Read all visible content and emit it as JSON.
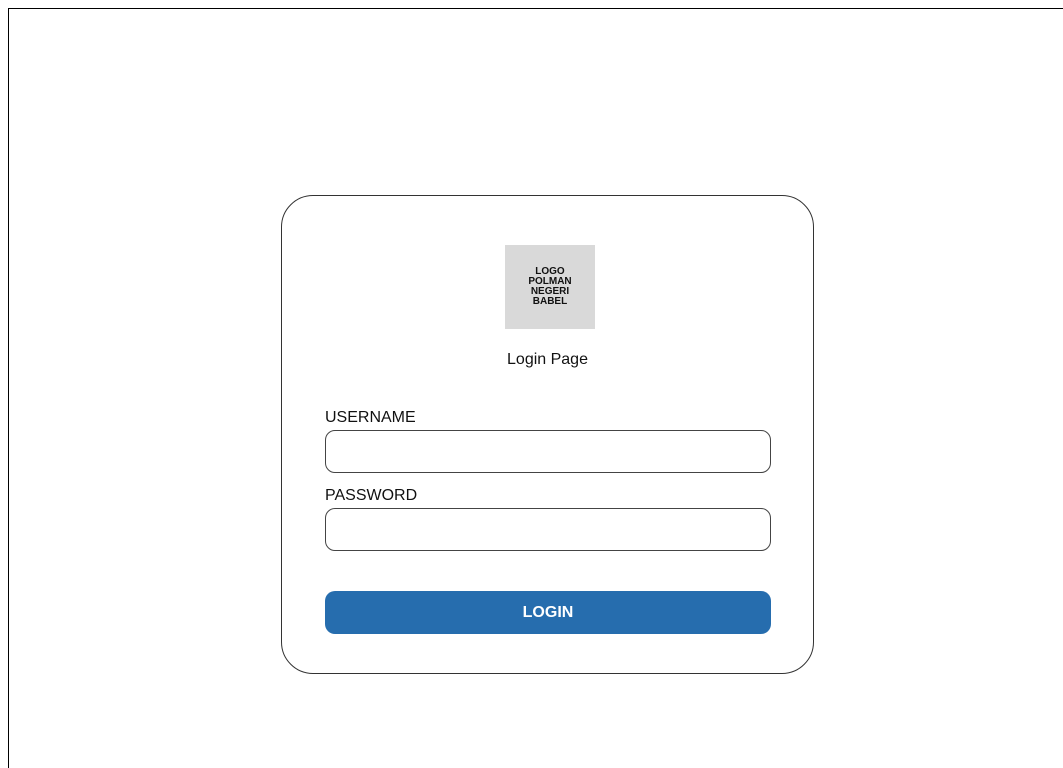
{
  "login_card": {
    "logo_text": "LOGO\nPOLMAN\nNEGERI\nBABEL",
    "title": "Login Page",
    "username": {
      "label": "USERNAME",
      "value": "",
      "placeholder": ""
    },
    "password": {
      "label": "PASSWORD",
      "value": "",
      "placeholder": ""
    },
    "login_button_label": "LOGIN"
  },
  "colors": {
    "accent": "#266dae",
    "logo_background": "#d9d9d9",
    "border": "#333333"
  }
}
